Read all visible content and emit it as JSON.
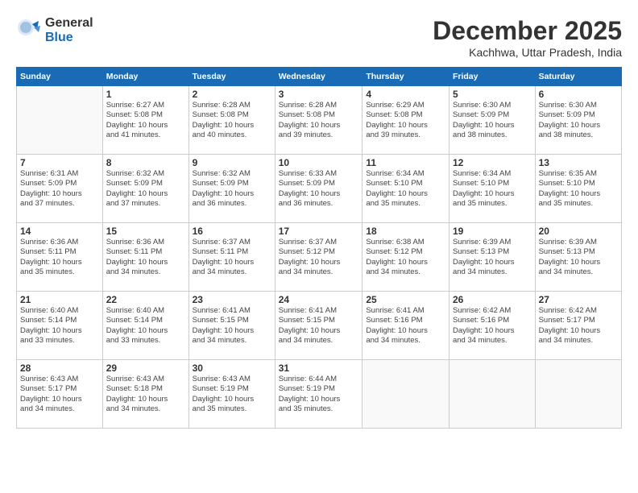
{
  "logo": {
    "general": "General",
    "blue": "Blue"
  },
  "title": "December 2025",
  "location": "Kachhwa, Uttar Pradesh, India",
  "weekdays": [
    "Sunday",
    "Monday",
    "Tuesday",
    "Wednesday",
    "Thursday",
    "Friday",
    "Saturday"
  ],
  "weeks": [
    [
      {
        "day": "",
        "info": ""
      },
      {
        "day": "1",
        "info": "Sunrise: 6:27 AM\nSunset: 5:08 PM\nDaylight: 10 hours\nand 41 minutes."
      },
      {
        "day": "2",
        "info": "Sunrise: 6:28 AM\nSunset: 5:08 PM\nDaylight: 10 hours\nand 40 minutes."
      },
      {
        "day": "3",
        "info": "Sunrise: 6:28 AM\nSunset: 5:08 PM\nDaylight: 10 hours\nand 39 minutes."
      },
      {
        "day": "4",
        "info": "Sunrise: 6:29 AM\nSunset: 5:08 PM\nDaylight: 10 hours\nand 39 minutes."
      },
      {
        "day": "5",
        "info": "Sunrise: 6:30 AM\nSunset: 5:09 PM\nDaylight: 10 hours\nand 38 minutes."
      },
      {
        "day": "6",
        "info": "Sunrise: 6:30 AM\nSunset: 5:09 PM\nDaylight: 10 hours\nand 38 minutes."
      }
    ],
    [
      {
        "day": "7",
        "info": "Sunrise: 6:31 AM\nSunset: 5:09 PM\nDaylight: 10 hours\nand 37 minutes."
      },
      {
        "day": "8",
        "info": "Sunrise: 6:32 AM\nSunset: 5:09 PM\nDaylight: 10 hours\nand 37 minutes."
      },
      {
        "day": "9",
        "info": "Sunrise: 6:32 AM\nSunset: 5:09 PM\nDaylight: 10 hours\nand 36 minutes."
      },
      {
        "day": "10",
        "info": "Sunrise: 6:33 AM\nSunset: 5:09 PM\nDaylight: 10 hours\nand 36 minutes."
      },
      {
        "day": "11",
        "info": "Sunrise: 6:34 AM\nSunset: 5:10 PM\nDaylight: 10 hours\nand 35 minutes."
      },
      {
        "day": "12",
        "info": "Sunrise: 6:34 AM\nSunset: 5:10 PM\nDaylight: 10 hours\nand 35 minutes."
      },
      {
        "day": "13",
        "info": "Sunrise: 6:35 AM\nSunset: 5:10 PM\nDaylight: 10 hours\nand 35 minutes."
      }
    ],
    [
      {
        "day": "14",
        "info": "Sunrise: 6:36 AM\nSunset: 5:11 PM\nDaylight: 10 hours\nand 35 minutes."
      },
      {
        "day": "15",
        "info": "Sunrise: 6:36 AM\nSunset: 5:11 PM\nDaylight: 10 hours\nand 34 minutes."
      },
      {
        "day": "16",
        "info": "Sunrise: 6:37 AM\nSunset: 5:11 PM\nDaylight: 10 hours\nand 34 minutes."
      },
      {
        "day": "17",
        "info": "Sunrise: 6:37 AM\nSunset: 5:12 PM\nDaylight: 10 hours\nand 34 minutes."
      },
      {
        "day": "18",
        "info": "Sunrise: 6:38 AM\nSunset: 5:12 PM\nDaylight: 10 hours\nand 34 minutes."
      },
      {
        "day": "19",
        "info": "Sunrise: 6:39 AM\nSunset: 5:13 PM\nDaylight: 10 hours\nand 34 minutes."
      },
      {
        "day": "20",
        "info": "Sunrise: 6:39 AM\nSunset: 5:13 PM\nDaylight: 10 hours\nand 34 minutes."
      }
    ],
    [
      {
        "day": "21",
        "info": "Sunrise: 6:40 AM\nSunset: 5:14 PM\nDaylight: 10 hours\nand 33 minutes."
      },
      {
        "day": "22",
        "info": "Sunrise: 6:40 AM\nSunset: 5:14 PM\nDaylight: 10 hours\nand 33 minutes."
      },
      {
        "day": "23",
        "info": "Sunrise: 6:41 AM\nSunset: 5:15 PM\nDaylight: 10 hours\nand 34 minutes."
      },
      {
        "day": "24",
        "info": "Sunrise: 6:41 AM\nSunset: 5:15 PM\nDaylight: 10 hours\nand 34 minutes."
      },
      {
        "day": "25",
        "info": "Sunrise: 6:41 AM\nSunset: 5:16 PM\nDaylight: 10 hours\nand 34 minutes."
      },
      {
        "day": "26",
        "info": "Sunrise: 6:42 AM\nSunset: 5:16 PM\nDaylight: 10 hours\nand 34 minutes."
      },
      {
        "day": "27",
        "info": "Sunrise: 6:42 AM\nSunset: 5:17 PM\nDaylight: 10 hours\nand 34 minutes."
      }
    ],
    [
      {
        "day": "28",
        "info": "Sunrise: 6:43 AM\nSunset: 5:17 PM\nDaylight: 10 hours\nand 34 minutes."
      },
      {
        "day": "29",
        "info": "Sunrise: 6:43 AM\nSunset: 5:18 PM\nDaylight: 10 hours\nand 34 minutes."
      },
      {
        "day": "30",
        "info": "Sunrise: 6:43 AM\nSunset: 5:19 PM\nDaylight: 10 hours\nand 35 minutes."
      },
      {
        "day": "31",
        "info": "Sunrise: 6:44 AM\nSunset: 5:19 PM\nDaylight: 10 hours\nand 35 minutes."
      },
      {
        "day": "",
        "info": ""
      },
      {
        "day": "",
        "info": ""
      },
      {
        "day": "",
        "info": ""
      }
    ]
  ]
}
